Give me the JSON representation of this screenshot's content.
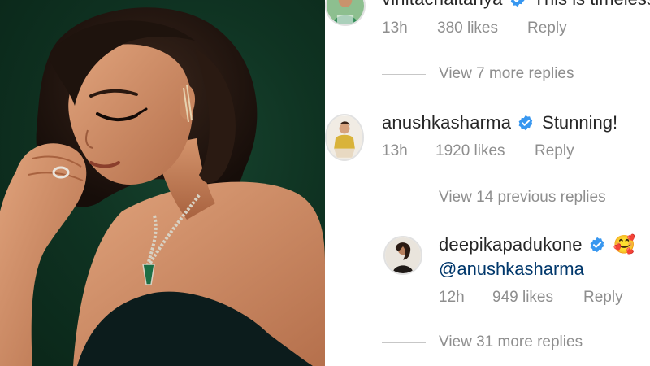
{
  "comments": [
    {
      "username": "vinitachaitanya",
      "text": "This is timeless",
      "time": "13h",
      "likes": "380 likes",
      "reply": "Reply",
      "view_replies": "View 7 more replies"
    },
    {
      "username": "anushkasharma",
      "text": "Stunning!",
      "time": "13h",
      "likes": "1920 likes",
      "reply": "Reply",
      "view_replies": "View 14 previous replies"
    }
  ],
  "reply": {
    "username": "deepikapadukone",
    "emoji": "🥰",
    "mention": "@anushkasharma",
    "time": "12h",
    "likes": "949 likes",
    "reply": "Reply",
    "view_replies": "View 31 more replies"
  },
  "colors": {
    "verified": "#3897f0",
    "meta_text": "#8e8e8e",
    "mention": "#00376b",
    "photo_background": "#0f3322"
  }
}
